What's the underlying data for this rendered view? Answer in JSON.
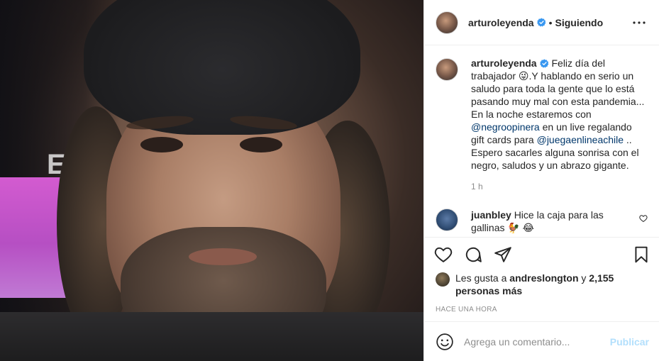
{
  "header": {
    "username": "arturoleyenda",
    "separator": "•",
    "follow_status": "Siguiendo",
    "more_icon": "more-horizontal-icon"
  },
  "caption": {
    "username": "arturoleyenda",
    "text_1": "Feliz día del trabajador 😜.Y hablando en serio un saludo para toda la gente que lo está pasando muy mal con esta pandemia... En la noche estaremos con",
    "mention_1": "@negroopinera",
    "text_2": "en un live regalando gift cards para",
    "mention_2": "@juegaenlineachile",
    "text_3": ".. Espero sacarles alguna sonrisa con el negro, saludos y un abrazo gigante.",
    "time": "1 h"
  },
  "comment": {
    "username": "juanbley",
    "text": "Hice la caja para las gallinas 🐓 😂"
  },
  "likes": {
    "prefix": "Les gusta a",
    "user": "andreslongton",
    "conj": "y",
    "others": "2,155 personas más"
  },
  "timestamp": "Hace una hora",
  "composer": {
    "placeholder": "Agrega un comentario...",
    "post_label": "Publicar"
  },
  "media": {
    "sign_text": "E"
  },
  "colors": {
    "verified": "#3897f0",
    "link": "#00376b",
    "muted": "#8e8e8e",
    "post_disabled": "#b2dffc"
  }
}
